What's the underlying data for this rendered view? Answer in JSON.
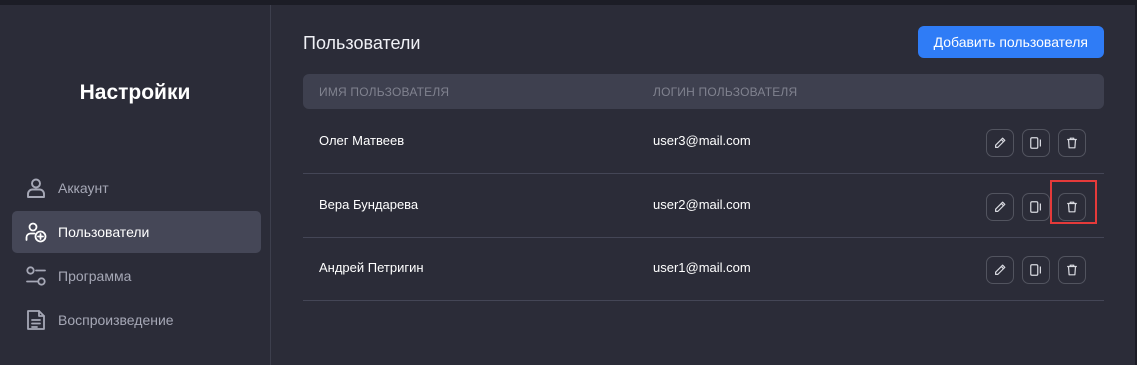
{
  "sidebar": {
    "title": "Настройки",
    "items": [
      {
        "label": "Аккаунт",
        "icon": "user-icon",
        "active": false
      },
      {
        "label": "Пользователи",
        "icon": "user-add-icon",
        "active": true
      },
      {
        "label": "Программа",
        "icon": "sliders-icon",
        "active": false
      },
      {
        "label": "Воспроизведение",
        "icon": "document-icon",
        "active": false
      }
    ]
  },
  "main": {
    "title": "Пользователи",
    "add_button_label": "Добавить пользователя",
    "columns": {
      "name": "ИМЯ ПОЛЬЗОВАТЕЛЯ",
      "login": "ЛОГИН ПОЛЬЗОВАТЕЛЯ"
    },
    "rows": [
      {
        "name": "Олег Матвеев",
        "login": "user3@mail.com"
      },
      {
        "name": "Вера Бундарева",
        "login": "user2@mail.com"
      },
      {
        "name": "Андрей Петригин",
        "login": "user1@mail.com"
      }
    ],
    "row_actions": [
      "edit-icon",
      "sidebar-panel-icon",
      "trash-icon"
    ]
  },
  "colors": {
    "background": "#2b2c38",
    "accent": "#2f7cf6",
    "active_nav": "#454757",
    "highlight": "#e53a3a"
  }
}
